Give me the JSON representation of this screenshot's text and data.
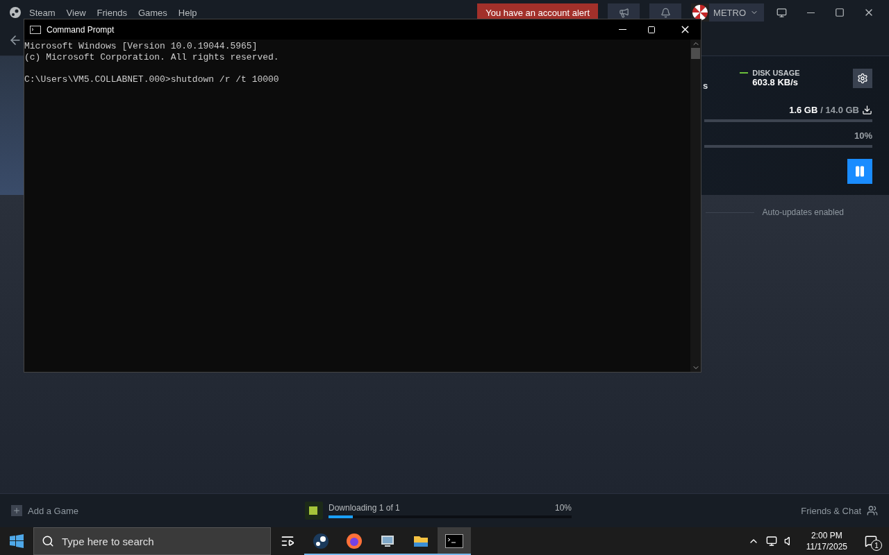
{
  "steam": {
    "menu": [
      "Steam",
      "View",
      "Friends",
      "Games",
      "Help"
    ],
    "alert": "You have an account alert",
    "user": "METRO",
    "downloads": {
      "cut_text": "s",
      "disk_usage_label": "DISK USAGE",
      "disk_usage_value": "603.8 KB/s",
      "downloaded": "1.6 GB",
      "total": "/ 14.0 GB",
      "percent": "10%"
    },
    "section": {
      "auto_updates": "Auto-updates enabled"
    },
    "bottom_bar": {
      "add_game": "Add a Game",
      "status": "Downloading 1 of 1",
      "percent": "10%",
      "level": 0.1,
      "friends": "Friends & Chat"
    }
  },
  "cmd": {
    "title": "Command Prompt",
    "lines": [
      "Microsoft Windows [Version 10.0.19044.5965]",
      "(c) Microsoft Corporation. All rights reserved."
    ],
    "command_line": "C:\\Users\\VM5.COLLABNET.000>shutdown /r /t 10000"
  },
  "taskbar": {
    "search_placeholder": "Type here to search",
    "apps": [
      {
        "kind": "steam",
        "running": true,
        "selected": false
      },
      {
        "kind": "firefox",
        "running": true,
        "selected": false
      },
      {
        "kind": "control-panel",
        "running": true,
        "selected": false
      },
      {
        "kind": "explorer",
        "running": true,
        "selected": false
      },
      {
        "kind": "terminal",
        "running": true,
        "selected": true
      }
    ],
    "time": "2:00 PM",
    "date": "11/17/2025",
    "notification_count": "1"
  }
}
